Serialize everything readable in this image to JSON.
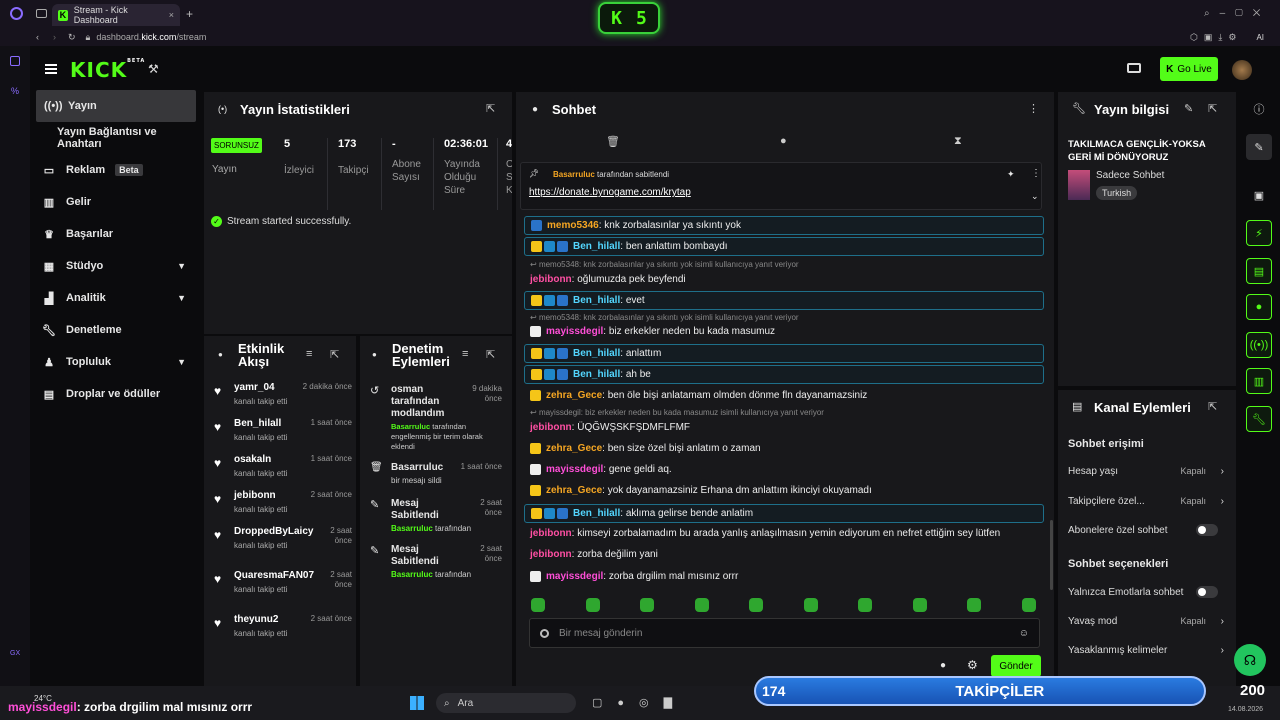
{
  "browser": {
    "tab_title": "Stream - Kick Dashboard",
    "url_host": "dashboard.",
    "url_domain": "kick.com",
    "url_path": "/stream",
    "new_tab": "+"
  },
  "overlay": {
    "k_badge": "K",
    "k_count": "5"
  },
  "header": {
    "logo": "KICK",
    "logo_sup": "BETA",
    "go_live": "Go Live"
  },
  "sidebar": {
    "items": [
      {
        "label": "Yayın",
        "icon": "broadcast-icon"
      },
      {
        "label": "Yayın Bağlantısı ve Anahtarı",
        "icon": ""
      },
      {
        "label": "Reklam",
        "icon": "ad-icon",
        "badge": "Beta"
      },
      {
        "label": "Gelir",
        "icon": "chart-icon"
      },
      {
        "label": "Başarılar",
        "icon": "trophy-icon"
      },
      {
        "label": "Stüdyo",
        "icon": "studio-icon"
      },
      {
        "label": "Analitik",
        "icon": "analytics-icon"
      },
      {
        "label": "Denetleme",
        "icon": "wrench-icon"
      },
      {
        "label": "Topluluk",
        "icon": "community-icon"
      },
      {
        "label": "Droplar ve ödüller",
        "icon": "gift-icon"
      }
    ]
  },
  "stats": {
    "title": "Yayın İstatistikleri",
    "status_badge": "SORUNSUZ",
    "status_label": "Yayın",
    "cols": [
      {
        "value": "5",
        "label": "İzleyici"
      },
      {
        "value": "173",
        "label": "Takipçi"
      },
      {
        "value": "-",
        "label": "Abone Sayısı"
      },
      {
        "value": "02:36:01",
        "label": "Yayında Olduğu Süre"
      },
      {
        "value": "4",
        "label": "O S K"
      }
    ],
    "success": "Stream started successfully."
  },
  "activity": {
    "title": "Etkinlik Akışı",
    "rows": [
      {
        "name": "yamr_04",
        "sub": "kanalı takip etti",
        "time": "2 dakika önce"
      },
      {
        "name": "Ben_hilall",
        "sub": "kanalı takip etti",
        "time": "1 saat önce"
      },
      {
        "name": "osakaln",
        "sub": "kanalı takip etti",
        "time": "1 saat önce"
      },
      {
        "name": "jebibonn",
        "sub": "kanalı takip etti",
        "time": "2 saat önce"
      },
      {
        "name": "DroppedByLaicy",
        "sub": "kanalı takip etti",
        "time": "2 saat önce"
      },
      {
        "name": "QuaresmaFAN07",
        "sub": "kanalı takip etti",
        "time": "2 saat önce"
      },
      {
        "name": "theyunu2",
        "sub": "kanalı takip etti",
        "time": "2 saat önce"
      }
    ]
  },
  "moderation": {
    "title": "Denetim Eylemleri",
    "rows": [
      {
        "name": "osman tarafından modlandım",
        "sub_user": "Basarruluc",
        "sub": "tarafından engellenmiş bir terim olarak eklendi",
        "time": "9 dakika önce"
      },
      {
        "name": "Basarruluc",
        "sub_user": "",
        "sub": "bir mesajı sildi",
        "time": "1 saat önce"
      },
      {
        "name": "Mesaj Sabitlendi",
        "sub_user": "Basarruluc",
        "sub": "tarafından",
        "time": "2 saat önce"
      },
      {
        "name": "Mesaj Sabitlendi",
        "sub_user": "Basarruluc",
        "sub": "tarafından",
        "time": "2 saat önce"
      }
    ]
  },
  "chat": {
    "title": "Sohbet",
    "pinned_by": "Basarruluc",
    "pinned_by_suffix": "tarafından sabitlendi",
    "pinned_link": "https://donate.bynogame.com/krytap",
    "input_placeholder": "Bir mesaj gönderin",
    "send": "Gönder",
    "lines": [
      {
        "kind": "boxed",
        "user": "memo5346",
        "color": "#f5a623",
        "text": "knk zorbalasınlar ya sıkıntı yok"
      },
      {
        "kind": "boxed",
        "user": "Ben_hilall",
        "color": "#53d6ff",
        "text": "ben anlattım bombaydı"
      },
      {
        "kind": "reply",
        "text": "memo5348: knk zorbalasınlar ya sıkıntı yok isimli kullanıcıya yanıt veriyor"
      },
      {
        "kind": "plain",
        "user": "jebibonn",
        "color": "#ff4fa3",
        "text": "oğlumuzda pek beyfendi"
      },
      {
        "kind": "boxed",
        "user": "Ben_hilall",
        "color": "#53d6ff",
        "text": "evet"
      },
      {
        "kind": "reply",
        "text": "memo5348: knk zorbalasınlar ya sıkıntı yok isimli kullanıcıya yanıt veriyor"
      },
      {
        "kind": "plain",
        "user": "mayissdegil",
        "color": "#ff4fd8",
        "text": "biz erkekler neden bu kada masumuz"
      },
      {
        "kind": "boxed",
        "user": "Ben_hilall",
        "color": "#53d6ff",
        "text": "anlattım"
      },
      {
        "kind": "boxed",
        "user": "Ben_hilall",
        "color": "#53d6ff",
        "text": "ah be"
      },
      {
        "kind": "plain",
        "user": "zehra_Gece",
        "color": "#f5a623",
        "text": "ben öle bişi anlatamam olmden dönme fln dayanamazsiniz"
      },
      {
        "kind": "reply",
        "text": "mayissdegil: biz erkekler neden bu kada masumuz isimli kullanıcıya yanıt veriyor"
      },
      {
        "kind": "plain",
        "user": "jebibonn",
        "color": "#ff4fa3",
        "text": "ÜQĞWŞSKFŞDMFLFMF"
      },
      {
        "kind": "plain",
        "user": "zehra_Gece",
        "color": "#f5a623",
        "text": "ben size özel bişi anlatım o zaman"
      },
      {
        "kind": "plain",
        "user": "mayissdegil",
        "color": "#ff4fd8",
        "text": "gene geldi aq."
      },
      {
        "kind": "plain",
        "user": "zehra_Gece",
        "color": "#f5a623",
        "text": "yok dayanamazsiniz Erhana dm anlattım ikinciyi okuyamadı"
      },
      {
        "kind": "boxed",
        "user": "Ben_hilall",
        "color": "#53d6ff",
        "text": "aklıma gelirse bende anlatim"
      },
      {
        "kind": "plain",
        "user": "jebibonn",
        "color": "#ff4fa3",
        "text": "kimseyi zorbalamadım bu arada yanlış anlaşılmasın yemin ediyorum en nefret ettiğim sey lütfen"
      },
      {
        "kind": "plain",
        "user": "jebibonn",
        "color": "#ff4fa3",
        "text": "zorba değilim yani"
      },
      {
        "kind": "plain",
        "user": "mayissdegil",
        "color": "#ff4fd8",
        "text": "zorba drgilim mal mısınız orrr"
      }
    ]
  },
  "stream_info": {
    "title": "Yayın bilgisi",
    "stream_title": "TAKILMACA GENÇLİK-YOKSA GERİ Mİ DÖNÜYORUZ",
    "category": "Sadece Sohbet",
    "language": "Turkish"
  },
  "channel_actions": {
    "title": "Kanal Eylemleri",
    "section1": "Sohbet erişimi",
    "section2": "Sohbet seçenekleri",
    "rows1": [
      {
        "label": "Hesap yaşı",
        "value": "Kapalı"
      },
      {
        "label": "Takipçilere özel...",
        "value": "Kapalı"
      },
      {
        "label": "Abonelere özel sohbet",
        "value": ""
      }
    ],
    "rows2": [
      {
        "label": "Yalnızca Emotlarla sohbet",
        "value": ""
      },
      {
        "label": "Yavaş mod",
        "value": "Kapalı"
      },
      {
        "label": "Yasaklanmış kelimeler",
        "value": ""
      }
    ]
  },
  "overlay_bottom": {
    "ticker_user": "mayissdegil",
    "ticker_text": ": zorba drgilim mal mısınız orrr",
    "follow_current": "174",
    "follow_label": "TAKİPÇİLER",
    "follow_goal": "200",
    "weather": "24°C",
    "date": "14.08.2026",
    "search": "Ara"
  }
}
